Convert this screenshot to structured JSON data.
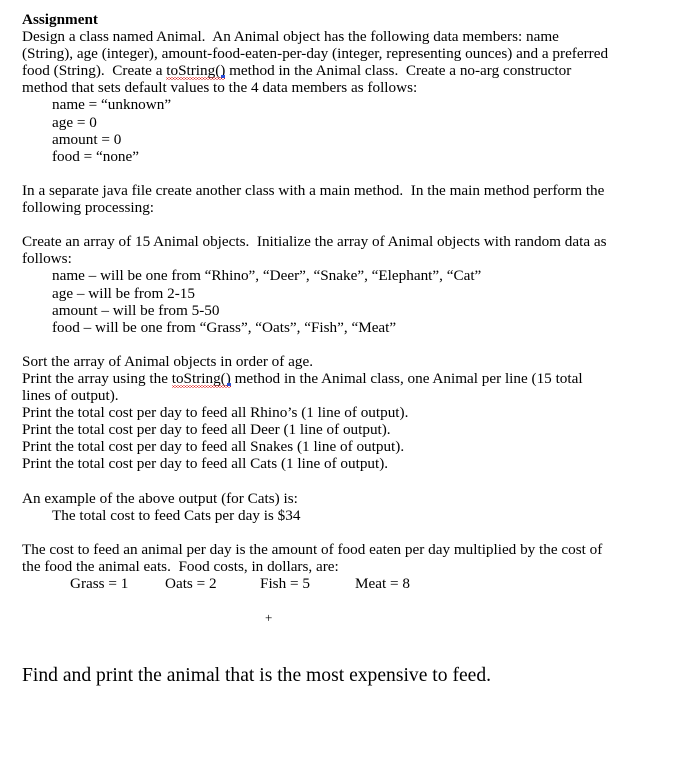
{
  "document": {
    "heading": "Assignment",
    "paragraph_1": {
      "lines": [
        "Design a class named Animal.  An Animal object has the following data members: name",
        "(String), age (integer), amount-food-eaten-per-day (integer, representing ounces) and a preferred",
        "food (String).  Create a ",
        " method in the Animal class.  Create a no-arg constructor",
        "method that sets default values to the 4 data members as follows:"
      ],
      "spellchecked_term": "toString()"
    },
    "default_values": [
      "name = “unknown”",
      "age = 0",
      "amount = 0",
      "food = “none”"
    ],
    "paragraph_2": [
      "In a separate java file create another class with a main method.  In the main method perform the",
      "following processing:"
    ],
    "paragraph_3": [
      "Create an array of 15 Animal objects.  Initialize the array of Animal objects with random data as",
      "follows:"
    ],
    "random_data_rules": [
      "name – will be one from “Rhino”, “Deer”, “Snake”, “Elephant”, “Cat”",
      "age – will be from 2-15",
      "amount – will be from 5-50",
      "food – will be one from “Grass”, “Oats”, “Fish”, “Meat”"
    ],
    "instructions": {
      "sort_line": "Sort the array of Animal objects in order of age.",
      "print_array_prefix": "Print the array using the ",
      "print_array_suffix": " method in the Animal class, one Animal per line (15 total",
      "print_array_wrap": "lines of output).",
      "spellchecked_term": "toString()",
      "print_lines": [
        "Print the total cost per day to feed all Rhino’s (1 line of output).",
        "Print the total cost per day to feed all Deer (1 line of output).",
        "Print the total cost per day to feed all Snakes (1 line of output).",
        "Print the total cost per day to feed all Cats (1 line of output)."
      ]
    },
    "example": {
      "intro": "An example of the above output (for Cats) is:",
      "output": "The total cost to feed Cats per day is $34"
    },
    "cost_explanation": [
      "The cost to feed an animal per day is the amount of food eaten per day multiplied by the cost of",
      "the food the animal eats.  Food costs, in dollars, are:"
    ],
    "food_costs": [
      "Grass = 1",
      "Oats = 2",
      "Fish = 5",
      "Meat = 8"
    ],
    "stray_symbol": "+",
    "final_line": "Find and print the animal that is the most expensive to feed."
  },
  "colors": {
    "page_background": "#ffffff",
    "text": "#000000",
    "spellcheck_underline": "#e01b1b",
    "grammar_mark": "#2a4fd8"
  }
}
